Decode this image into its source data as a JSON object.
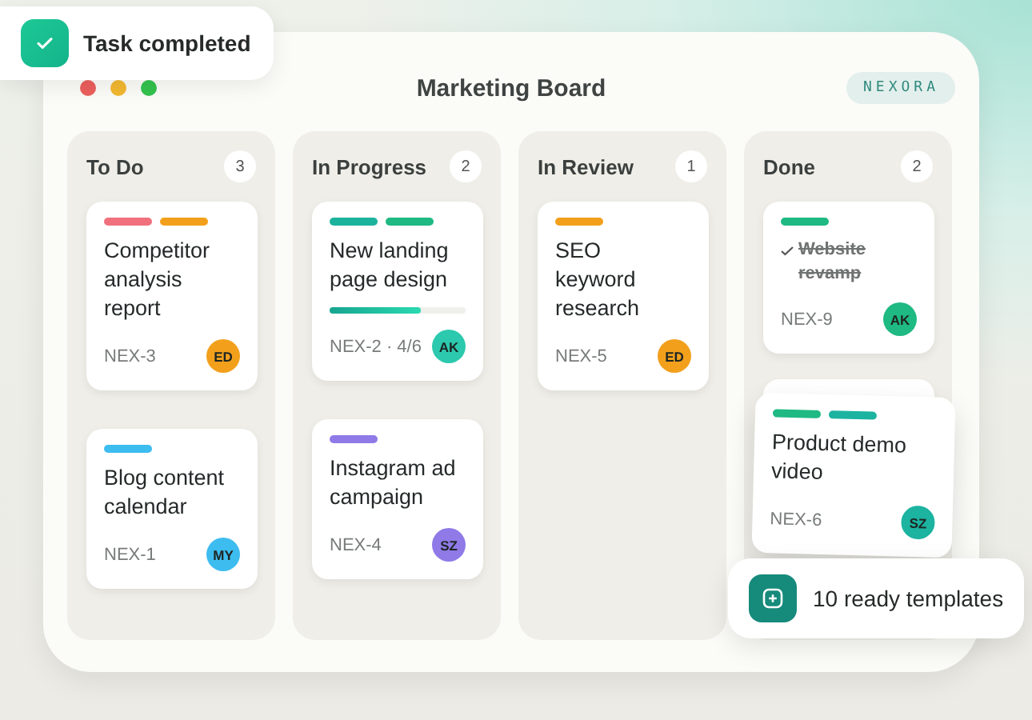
{
  "toast": {
    "text": "Task completed"
  },
  "window": {
    "title": "Marketing Board",
    "brand": "NEXORA"
  },
  "columns": [
    {
      "name": "To Do",
      "count": "3",
      "cards": [
        {
          "kind": "task",
          "tags": [
            {
              "color": "#f0707e"
            },
            {
              "color": "#f2a01c"
            }
          ],
          "title": "Competitor analysis report",
          "done": false,
          "ref": "NEX-3",
          "assignee": "ED",
          "color": "#f2a01c"
        },
        {
          "kind": "task",
          "tags": [
            {
              "color": "#3dbcf0"
            }
          ],
          "title": "Blog content calendar",
          "done": false,
          "ref": "NEX-1",
          "assignee": "MY",
          "color": "#3dbcf0"
        }
      ]
    },
    {
      "name": "In Progress",
      "count": "2",
      "cards": [
        {
          "kind": "task",
          "tags": [
            {
              "color": "#1cb39c"
            },
            {
              "color": "#1fb983"
            }
          ],
          "title": "New landing page design",
          "done": false,
          "level": 0.667,
          "ref": "NEX-2 · 4/6",
          "assignee": "AK",
          "color": "#2cc9ae"
        },
        {
          "kind": "task",
          "tags": [
            {
              "color": "#8f7ae8"
            }
          ],
          "title": "Instagram ad campaign",
          "done": false,
          "ref": "NEX-4",
          "assignee": "SZ",
          "color": "#8f7ae8"
        }
      ]
    },
    {
      "name": "In Review",
      "count": "1",
      "cards": [
        {
          "kind": "task",
          "tags": [
            {
              "color": "#f2a01c"
            }
          ],
          "title": "SEO keyword research",
          "done": false,
          "ref": "NEX-5",
          "assignee": "ED",
          "color": "#f2a01c"
        }
      ]
    },
    {
      "name": "Done",
      "count": "2",
      "cards": [
        {
          "kind": "task",
          "tags": [
            {
              "color": "#1fb983"
            }
          ],
          "title": "Website revamp",
          "done": true,
          "ref": "NEX-9",
          "assignee": "AK",
          "color": "#1fb983"
        },
        {
          "kind": "dragging",
          "tags": [
            {
              "color": "#1fb983"
            },
            {
              "color": "#1cb3a0"
            }
          ],
          "title": "Product demo video",
          "done": false,
          "ref": "NEX-6",
          "assignee": "SZ",
          "color": "#1cb3a0"
        }
      ]
    }
  ],
  "templates": {
    "text": "10 ready templates"
  }
}
